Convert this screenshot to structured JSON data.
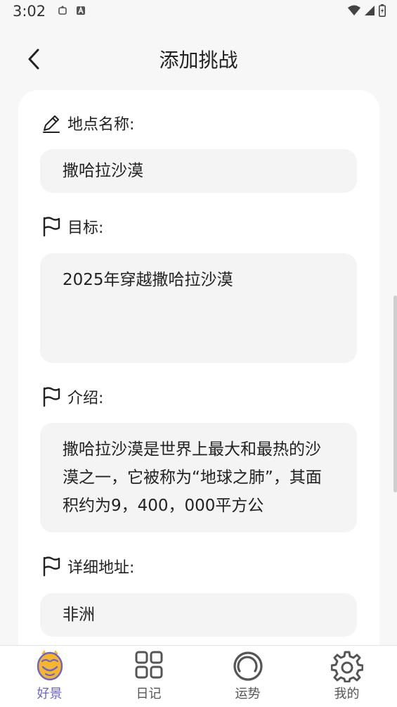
{
  "status": {
    "time": "3:02"
  },
  "header": {
    "title": "添加挑战"
  },
  "form": {
    "location_label": "地点名称:",
    "location_value": "撒哈拉沙漠",
    "goal_label": "目标:",
    "goal_value": "2025年穿越撒哈拉沙漠",
    "intro_label": "介绍:",
    "intro_value": "撒哈拉沙漠是世界上最大和最热的沙漠之一，它被称为“地球之肺”，其面积约为9，400，000平方公",
    "address_label": "详细地址:",
    "address_value": "非洲"
  },
  "tabs": [
    {
      "label": "好景",
      "active": true
    },
    {
      "label": "日记"
    },
    {
      "label": "运势"
    },
    {
      "label": "我的"
    }
  ],
  "colors": {
    "accent": "#6c64c8",
    "icon_gray": "#555555"
  }
}
